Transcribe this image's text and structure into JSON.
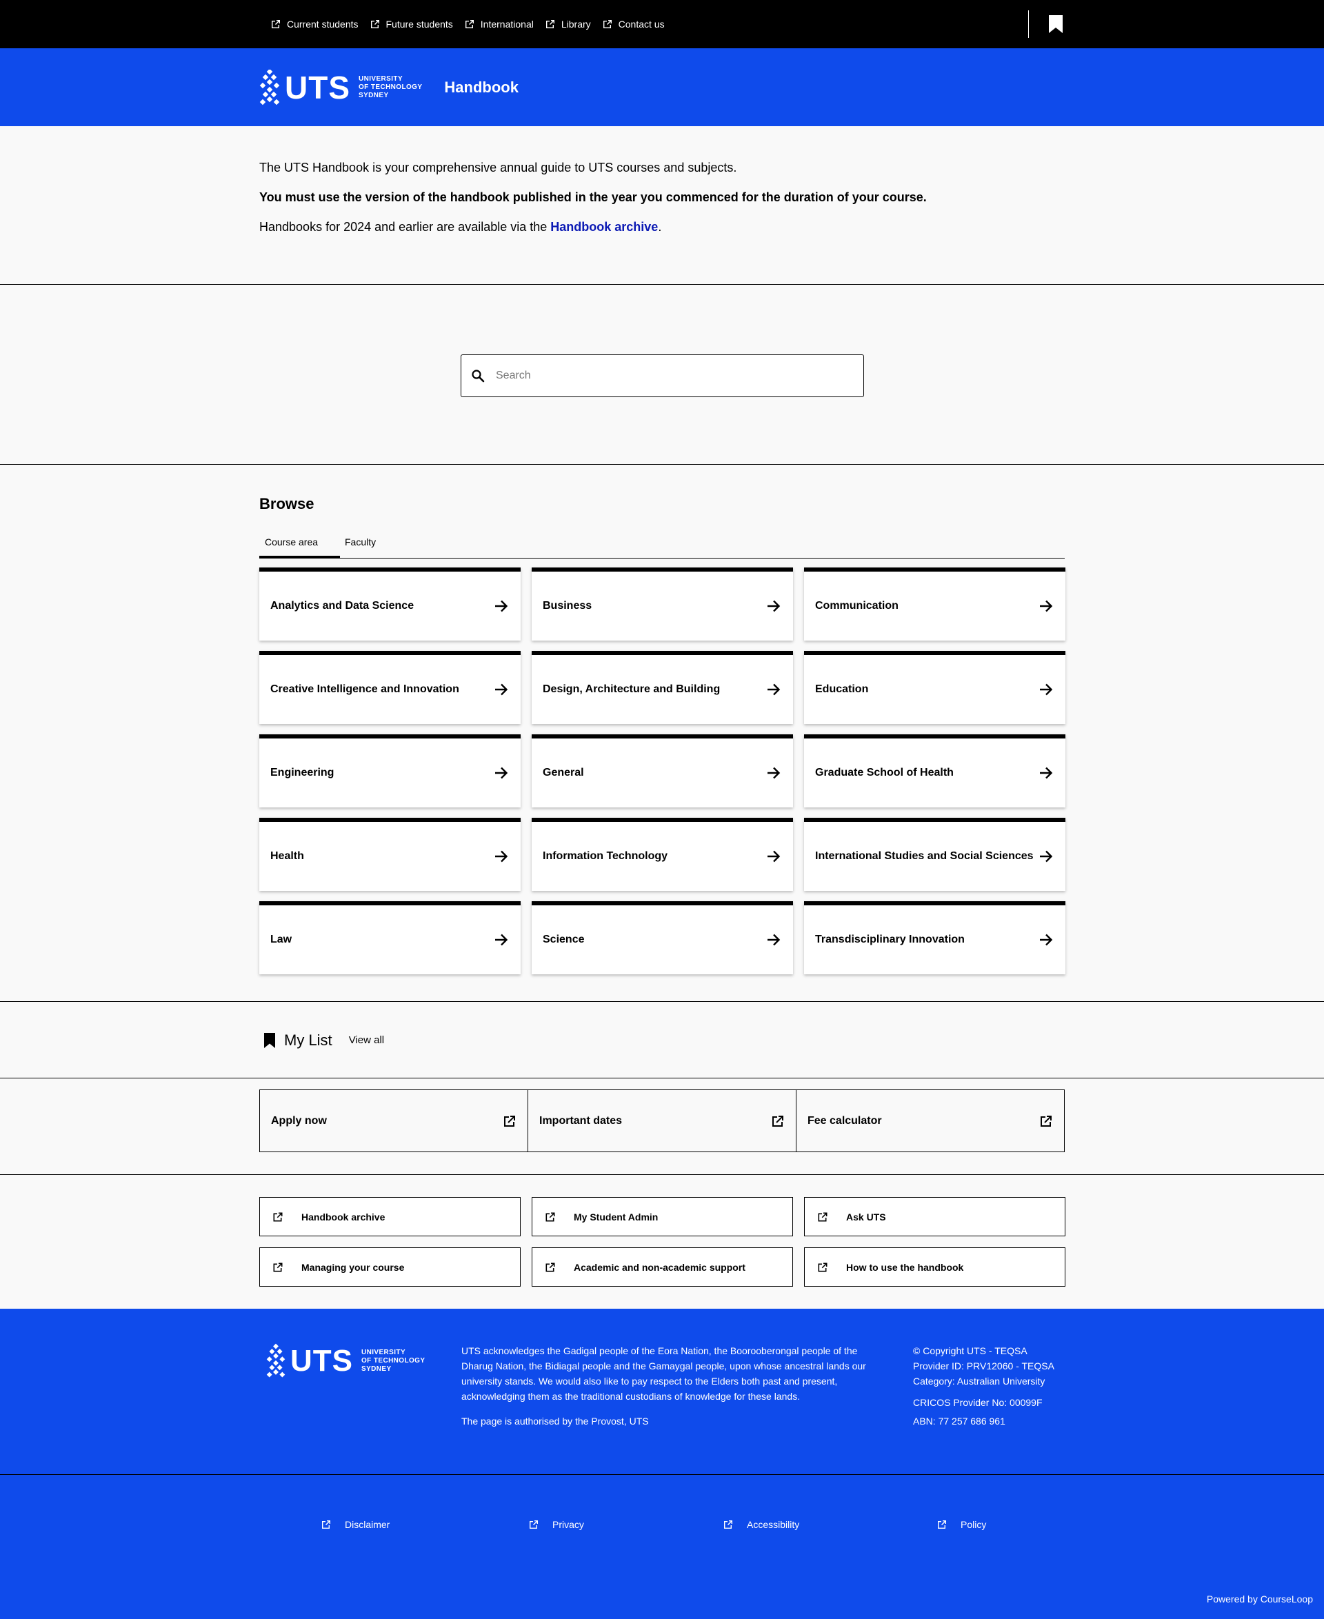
{
  "topnav": {
    "links": [
      "Current students",
      "Future students",
      "International",
      "Library",
      "Contact us"
    ]
  },
  "logo": {
    "wordmark": "UTS",
    "line1": "University",
    "line2": "of Technology",
    "line3": "Sydney"
  },
  "header": {
    "title": "Handbook"
  },
  "intro": {
    "p1": "The UTS Handbook is your comprehensive annual guide to UTS courses and subjects.",
    "p2": "You must use the version of the handbook published in the year you commenced for the duration of your course.",
    "p3_prefix": "Handbooks for 2024 and earlier are available via the ",
    "p3_link": "Handbook archive",
    "p3_suffix": "."
  },
  "search": {
    "placeholder": "Search"
  },
  "browse": {
    "title": "Browse",
    "tabs": [
      "Course area",
      "Faculty"
    ],
    "cards": [
      "Analytics and Data Science",
      "Business",
      "Communication",
      "Creative Intelligence and Innovation",
      "Design, Architecture and Building",
      "Education",
      "Engineering",
      "General",
      "Graduate School of Health",
      "Health",
      "Information Technology",
      "International Studies and Social Sciences",
      "Law",
      "Science",
      "Transdisciplinary Innovation"
    ]
  },
  "mylist": {
    "title": "My List",
    "view_all": "View all"
  },
  "actions": [
    "Apply now",
    "Important dates",
    "Fee calculator"
  ],
  "quicklinks": [
    "Handbook archive",
    "My Student Admin",
    "Ask UTS",
    "Managing your course",
    "Academic and non-academic support",
    "How to use the handbook"
  ],
  "footer": {
    "ack": "UTS acknowledges the Gadigal people of the Eora Nation, the Boorooberongal people of the Dharug Nation, the Bidiagal people and the Gamaygal people, upon whose ancestral lands our university stands. We would also like to pay respect to the Elders both past and present, acknowledging them as the traditional custodians of knowledge for these lands.",
    "authorised": "The page is authorised by the Provost, UTS",
    "copyright": "© Copyright UTS - TEQSA",
    "provider_id": "Provider ID: PRV12060 - TEQSA",
    "category": "Category: Australian University",
    "cricos": "CRICOS Provider No: 00099F",
    "abn": "ABN: 77 257 686 961",
    "links": [
      "Disclaimer",
      "Privacy",
      "Accessibility",
      "Policy"
    ],
    "powered": "Powered by CourseLoop"
  },
  "colors": {
    "brand_blue": "#0f4beb",
    "link_blue": "#0c1ab4",
    "black": "#000000",
    "background": "#f9f9f9"
  },
  "icons": [
    "external-link-icon",
    "bookmark-icon",
    "search-icon",
    "arrow-right-icon",
    "uts-logo-icon"
  ]
}
